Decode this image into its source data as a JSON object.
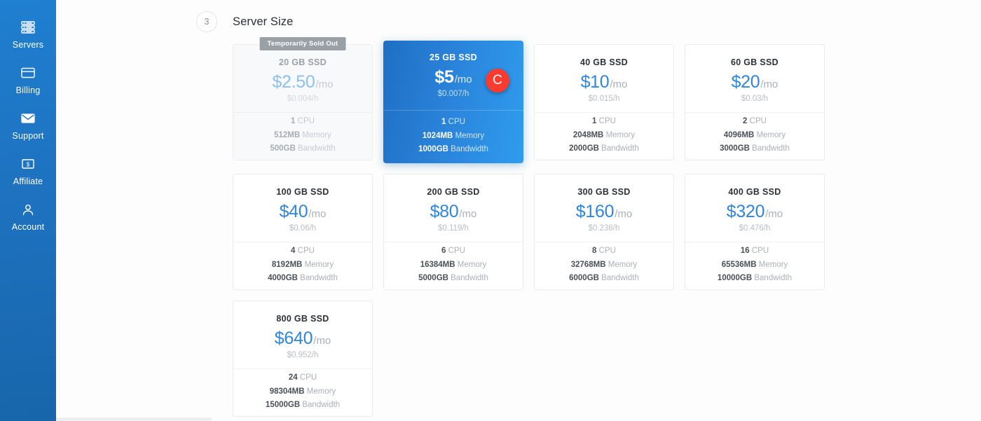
{
  "sidebar": {
    "items": [
      {
        "label": "Servers",
        "icon": "servers-icon"
      },
      {
        "label": "Billing",
        "icon": "credit-card-icon"
      },
      {
        "label": "Support",
        "icon": "envelope-icon"
      },
      {
        "label": "Affiliate",
        "icon": "dollar-bill-icon"
      },
      {
        "label": "Account",
        "icon": "user-icon"
      }
    ]
  },
  "section": {
    "step_number": "3",
    "title": "Server Size"
  },
  "labels": {
    "per_month": "/mo",
    "cpu": "CPU",
    "memory": "Memory",
    "bandwidth": "Bandwidth",
    "sold_out_badge": "Temporarily Sold Out"
  },
  "cursor": {
    "glyph": "C",
    "color": "#fb3b30"
  },
  "colors": {
    "accent_blue": "#2f86df",
    "sidebar_blue": "#1e72bf",
    "selected_card_from": "#1f6fc4",
    "selected_card_to": "#2f9ced",
    "sold_out_gray": "#9aa0a6"
  },
  "plans": [
    {
      "size": "20 GB SSD",
      "price": "$2.50",
      "hourly": "$0.004/h",
      "cpu": "1",
      "memory": "512MB",
      "bandwidth": "500GB",
      "state": "soldout"
    },
    {
      "size": "25 GB SSD",
      "price": "$5",
      "hourly": "$0.007/h",
      "cpu": "1",
      "memory": "1024MB",
      "bandwidth": "1000GB",
      "state": "selected"
    },
    {
      "size": "40 GB SSD",
      "price": "$10",
      "hourly": "$0.015/h",
      "cpu": "1",
      "memory": "2048MB",
      "bandwidth": "2000GB",
      "state": "default"
    },
    {
      "size": "60 GB SSD",
      "price": "$20",
      "hourly": "$0.03/h",
      "cpu": "2",
      "memory": "4096MB",
      "bandwidth": "3000GB",
      "state": "default"
    },
    {
      "size": "100 GB SSD",
      "price": "$40",
      "hourly": "$0.06/h",
      "cpu": "4",
      "memory": "8192MB",
      "bandwidth": "4000GB",
      "state": "default"
    },
    {
      "size": "200 GB SSD",
      "price": "$80",
      "hourly": "$0.119/h",
      "cpu": "6",
      "memory": "16384MB",
      "bandwidth": "5000GB",
      "state": "default"
    },
    {
      "size": "300 GB SSD",
      "price": "$160",
      "hourly": "$0.238/h",
      "cpu": "8",
      "memory": "32768MB",
      "bandwidth": "6000GB",
      "state": "default"
    },
    {
      "size": "400 GB SSD",
      "price": "$320",
      "hourly": "$0.476/h",
      "cpu": "16",
      "memory": "65536MB",
      "bandwidth": "10000GB",
      "state": "default"
    },
    {
      "size": "800 GB SSD",
      "price": "$640",
      "hourly": "$0.952/h",
      "cpu": "24",
      "memory": "98304MB",
      "bandwidth": "15000GB",
      "state": "default"
    }
  ]
}
